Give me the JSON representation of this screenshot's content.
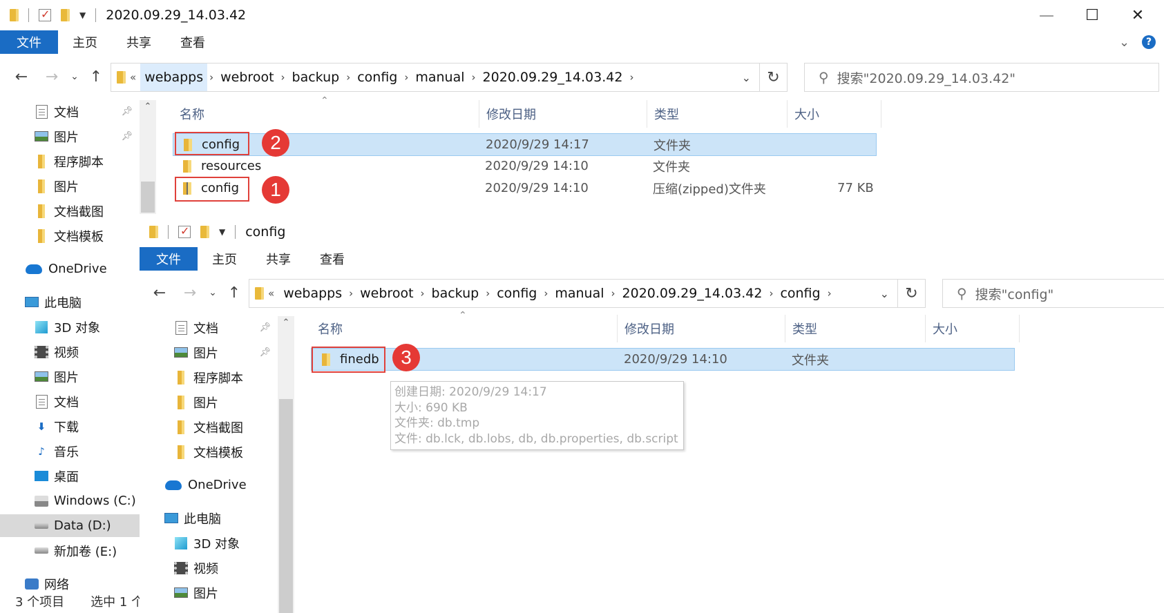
{
  "windows": [
    {
      "title": "2020.09.29_14.03.42",
      "controls": {
        "minimize": "—",
        "maximize": "☐",
        "close": "✕"
      },
      "tabs": [
        {
          "label": "文件"
        },
        {
          "label": "主页"
        },
        {
          "label": "共享"
        },
        {
          "label": "查看"
        }
      ],
      "address": {
        "overflow": "«",
        "crumbs": [
          "webapps",
          "webroot",
          "backup",
          "config",
          "manual",
          "2020.09.29_14.03.42"
        ]
      },
      "search_placeholder": "搜索\"2020.09.29_14.03.42\"",
      "nav_items": [
        {
          "label": "文档",
          "icon": "document-icon",
          "pinned": true
        },
        {
          "label": "图片",
          "icon": "picture-icon",
          "pinned": true
        },
        {
          "label": "程序脚本",
          "icon": "folder-icon"
        },
        {
          "label": "图片",
          "icon": "folder-icon"
        },
        {
          "label": "文档截图",
          "icon": "folder-icon"
        },
        {
          "label": "文档模板",
          "icon": "folder-icon"
        },
        {
          "label": "OneDrive",
          "icon": "onedrive-icon"
        },
        {
          "label": "此电脑",
          "icon": "this-pc-icon"
        },
        {
          "label": "3D 对象",
          "icon": "3d-objects-icon"
        },
        {
          "label": "视频",
          "icon": "video-icon"
        },
        {
          "label": "图片",
          "icon": "picture-icon"
        },
        {
          "label": "文档",
          "icon": "document-icon"
        },
        {
          "label": "下载",
          "icon": "download-icon"
        },
        {
          "label": "音乐",
          "icon": "music-icon"
        },
        {
          "label": "桌面",
          "icon": "desktop-icon"
        },
        {
          "label": "Windows (C:)",
          "icon": "windows-drive-icon"
        },
        {
          "label": "Data (D:)",
          "icon": "drive-icon",
          "selected": true
        },
        {
          "label": "新加卷 (E:)",
          "icon": "drive-icon"
        },
        {
          "label": "网络",
          "icon": "network-icon"
        }
      ],
      "columns": [
        "名称",
        "修改日期",
        "类型",
        "大小"
      ],
      "files": [
        {
          "name": "config",
          "date": "2020/9/29 14:17",
          "type": "文件夹",
          "size": "",
          "selected": true,
          "zip": false
        },
        {
          "name": "resources",
          "date": "2020/9/29 14:10",
          "type": "文件夹",
          "size": "",
          "selected": false,
          "zip": false
        },
        {
          "name": "config",
          "date": "2020/9/29 14:10",
          "type": "压缩(zipped)文件夹",
          "size": "77 KB",
          "selected": false,
          "zip": true
        }
      ],
      "status": {
        "count": "3 个项目",
        "selected": "选中 1 个"
      }
    },
    {
      "title": "config",
      "tabs": [
        {
          "label": "文件"
        },
        {
          "label": "主页"
        },
        {
          "label": "共享"
        },
        {
          "label": "查看"
        }
      ],
      "address": {
        "overflow": "«",
        "crumbs": [
          "webapps",
          "webroot",
          "backup",
          "config",
          "manual",
          "2020.09.29_14.03.42",
          "config"
        ]
      },
      "search_placeholder": "搜索\"config\"",
      "nav_items": [
        {
          "label": "文档",
          "icon": "document-icon",
          "pinned": true
        },
        {
          "label": "图片",
          "icon": "picture-icon",
          "pinned": true
        },
        {
          "label": "程序脚本",
          "icon": "folder-icon"
        },
        {
          "label": "图片",
          "icon": "folder-icon"
        },
        {
          "label": "文档截图",
          "icon": "folder-icon"
        },
        {
          "label": "文档模板",
          "icon": "folder-icon"
        },
        {
          "label": "OneDrive",
          "icon": "onedrive-icon"
        },
        {
          "label": "此电脑",
          "icon": "this-pc-icon"
        },
        {
          "label": "3D 对象",
          "icon": "3d-objects-icon"
        },
        {
          "label": "视频",
          "icon": "video-icon"
        },
        {
          "label": "图片",
          "icon": "picture-icon"
        }
      ],
      "columns": [
        "名称",
        "修改日期",
        "类型",
        "大小"
      ],
      "files": [
        {
          "name": "finedb",
          "date": "2020/9/29 14:10",
          "type": "文件夹",
          "size": "",
          "selected": true,
          "zip": false
        }
      ],
      "tooltip": [
        "创建日期: 2020/9/29 14:17",
        "大小: 690 KB",
        "文件夹: db.tmp",
        "文件: db.lck, db.lobs, db, db.properties, db.script"
      ]
    }
  ],
  "annotations": [
    {
      "number": "1"
    },
    {
      "number": "2"
    },
    {
      "number": "3"
    }
  ],
  "colors": {
    "accent": "#1a6cc4",
    "selection": "#cce4f8",
    "annotation_red": "#e53935"
  }
}
